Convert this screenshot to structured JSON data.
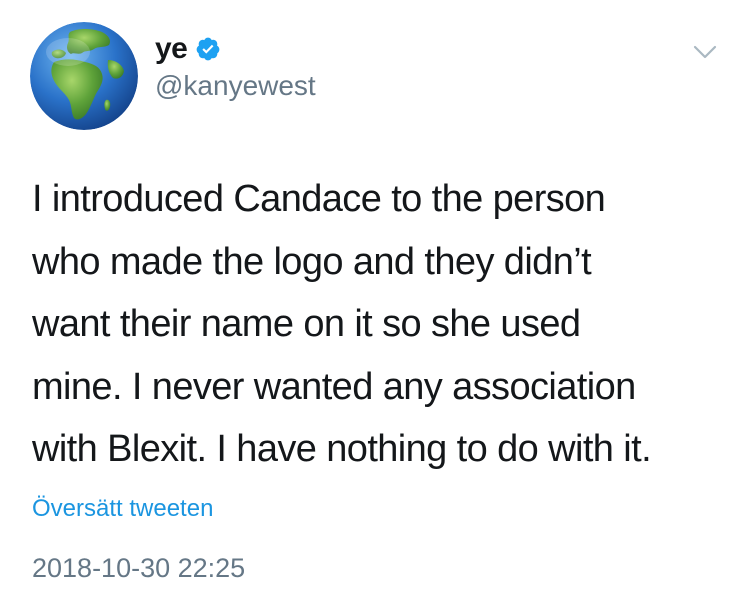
{
  "account": {
    "display_name": "ye",
    "handle": "@kanyewest",
    "verified": true,
    "avatar_icon": "globe-europe-africa-icon"
  },
  "tweet": {
    "lines": [
      "I introduced Candace to the person",
      "who made the logo and they didn’t",
      "want their name on it so she used",
      "mine. I never wanted any association",
      "with Blexit. I have nothing to do with it."
    ],
    "translate_label": "Översätt tweeten",
    "timestamp": "2018-10-30 22:25"
  },
  "colors": {
    "text": "#14171a",
    "secondary": "#657786",
    "link": "#1b95e0",
    "verified_badge": "#1da1f2",
    "chevron": "#aab8c2"
  }
}
